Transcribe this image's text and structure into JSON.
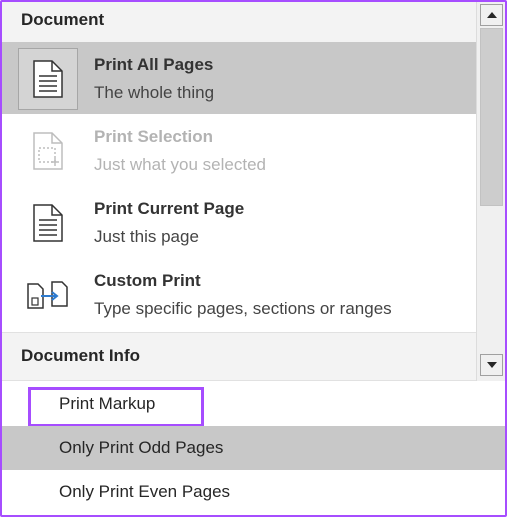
{
  "sections": {
    "document_label": "Document",
    "document_info_label": "Document Info"
  },
  "options": [
    {
      "title": "Print All Pages",
      "subtitle": "The whole thing",
      "icon": "page-lines-icon",
      "selected": true,
      "disabled": false
    },
    {
      "title": "Print Selection",
      "subtitle": "Just what you selected",
      "icon": "selection-page-icon",
      "selected": false,
      "disabled": true
    },
    {
      "title": "Print Current Page",
      "subtitle": "Just this page",
      "icon": "current-page-icon",
      "selected": false,
      "disabled": false
    },
    {
      "title": "Custom Print",
      "subtitle": "Type specific pages, sections or ranges",
      "icon": "custom-print-icon",
      "selected": false,
      "disabled": false
    }
  ],
  "menu": [
    {
      "label": "Print Markup",
      "highlighted": true
    },
    {
      "label": "Only Print Odd Pages",
      "hovered": true
    },
    {
      "label": "Only Print Even Pages"
    }
  ],
  "scrollbar": {
    "up_icon": "triangle-up-icon",
    "down_icon": "triangle-down-icon"
  },
  "colors": {
    "accent": "#a64dff",
    "selected_bg": "#c8c8c8",
    "header_bg": "#f3f3f3",
    "disabled_text": "#b3b3b3"
  }
}
